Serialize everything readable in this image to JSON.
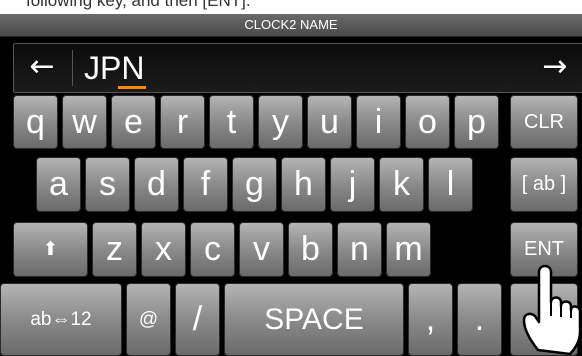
{
  "caption": "following key, and then [ENT].",
  "screen": {
    "title": "CLOCK2 NAME",
    "entry_text": "JPN",
    "left_arrow": "←",
    "right_arrow": "→",
    "accent_cursor_color": "#ff8c00"
  },
  "keyboard": {
    "row1": [
      "q",
      "w",
      "e",
      "r",
      "t",
      "y",
      "u",
      "i",
      "o",
      "p"
    ],
    "row2": [
      "a",
      "s",
      "d",
      "f",
      "g",
      "h",
      "j",
      "k",
      "l"
    ],
    "row3": [
      "z",
      "x",
      "c",
      "v",
      "b",
      "n",
      "m"
    ],
    "clr": "CLR",
    "ab": "[ ab ]",
    "ent": "ENT",
    "shift": "⬆",
    "mode": "ab⇔12",
    "at": "@",
    "slash": "/",
    "space": "SPACE",
    "comma": ",",
    "period": "."
  },
  "icons": [
    "shift-arrow-icon",
    "left-arrow-icon",
    "right-arrow-icon",
    "pointing-hand-icon"
  ]
}
